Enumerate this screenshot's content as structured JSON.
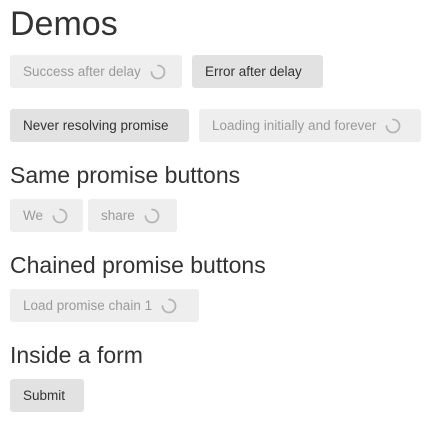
{
  "sections": {
    "demos": {
      "title": "Demos",
      "success_after_delay": "Success after delay",
      "error_after_delay": "Error after delay",
      "never_resolving_promise": "Never resolving promise",
      "loading_initially_and_forever": "Loading initially and forever"
    },
    "same_promise": {
      "title": "Same promise buttons",
      "we": "We",
      "share": "share"
    },
    "chained_promise": {
      "title": "Chained promise buttons",
      "load_chain": "Load promise chain 1"
    },
    "form": {
      "title": "Inside a form",
      "submit": "Submit"
    }
  },
  "icons": {
    "spinner": "spinner-icon"
  },
  "colors": {
    "loading_bg": "#eeeeee",
    "idle_bg": "#e2e2e2",
    "loading_text": "#9a9a9a",
    "idle_text": "#333333"
  }
}
